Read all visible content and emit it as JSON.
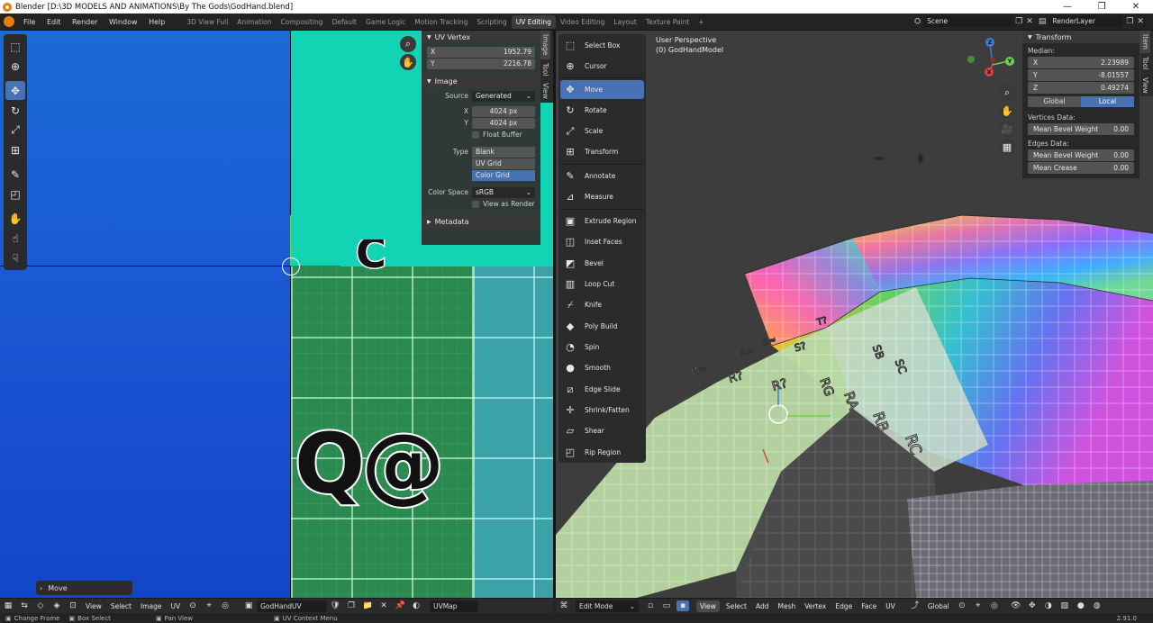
{
  "window": {
    "title": "Blender [D:\\3D MODELS AND ANIMATIONS\\By The Gods\\GodHand.blend]",
    "controls": [
      "—",
      "❐",
      "✕"
    ]
  },
  "topbar": {
    "menus": [
      "File",
      "Edit",
      "Render",
      "Window",
      "Help"
    ],
    "workspaces": [
      "3D View Full",
      "Animation",
      "Compositing",
      "Default",
      "Game Logic",
      "Motion Tracking",
      "Scripting",
      "UV Editing",
      "Video Editing",
      "Layout",
      "Texture Paint"
    ],
    "active_workspace": "UV Editing",
    "add_tab": "+",
    "scene": "Scene",
    "render_layer": "RenderLayer"
  },
  "uv_editor": {
    "uv_vertex": {
      "title": "UV Vertex",
      "x_label": "X",
      "x_value": "1952.79",
      "y_label": "Y",
      "y_value": "2216.78"
    },
    "image": {
      "title": "Image",
      "source_label": "Source",
      "source_value": "Generated",
      "x_label": "X",
      "x_value": "4024 px",
      "y_label": "Y",
      "y_value": "4024 px",
      "float_buffer": "Float Buffer",
      "type_label": "Type",
      "type_options": [
        "Blank",
        "UV Grid",
        "Color Grid"
      ],
      "type_selected": "Color Grid",
      "color_space_label": "Color Space",
      "color_space_value": "sRGB",
      "view_as_render": "View as Render"
    },
    "metadata_title": "Metadata",
    "side_tabs": [
      "Image",
      "Tool",
      "View"
    ],
    "glyph_text": "Q@",
    "glyph_top_text": "C",
    "redo_panel": "Move",
    "header": {
      "menus": [
        "View",
        "Select",
        "Image",
        "UV"
      ],
      "image_name": "GodHandUV",
      "uv_map": "UVMap"
    }
  },
  "viewport": {
    "perspective": "User Perspective",
    "object": "(0) GodHandModel",
    "tools": [
      {
        "label": "Select Box",
        "icon": "⬚"
      },
      {
        "label": "Cursor",
        "icon": "⊕"
      },
      {
        "label": "Move",
        "icon": "✥"
      },
      {
        "label": "Rotate",
        "icon": "↻"
      },
      {
        "label": "Scale",
        "icon": "⤢"
      },
      {
        "label": "Transform",
        "icon": "⊞"
      },
      {
        "label": "Annotate",
        "icon": "✎"
      },
      {
        "label": "Measure",
        "icon": "📐"
      },
      {
        "label": "Extrude Region",
        "icon": "▣"
      },
      {
        "label": "Inset Faces",
        "icon": "◫"
      },
      {
        "label": "Bevel",
        "icon": "◩"
      },
      {
        "label": "Loop Cut",
        "icon": "▥"
      },
      {
        "label": "Knife",
        "icon": "⌿"
      },
      {
        "label": "Poly Build",
        "icon": "◆"
      },
      {
        "label": "Spin",
        "icon": "◔"
      },
      {
        "label": "Smooth",
        "icon": "●"
      },
      {
        "label": "Edge Slide",
        "icon": "⧄"
      },
      {
        "label": "Shrink/Fatten",
        "icon": "✛"
      },
      {
        "label": "Shear",
        "icon": "▱"
      },
      {
        "label": "Rip Region",
        "icon": "◰"
      }
    ],
    "active_tool": "Move",
    "transform": {
      "title": "Transform",
      "median_label": "Median:",
      "x_label": "X",
      "x_value": "2.23989",
      "y_label": "Y",
      "y_value": "-8.01557",
      "z_label": "Z",
      "z_value": "0.49274",
      "orientation": [
        "Global",
        "Local"
      ],
      "orientation_selected": "Local",
      "vertices_data_label": "Vertices Data:",
      "mean_bevel_weight_label": "Mean Bevel Weight",
      "vertex_bevel_value": "0.00",
      "edges_data_label": "Edges Data:",
      "edge_bevel_value": "0.00",
      "mean_crease_label": "Mean Crease",
      "mean_crease_value": "0.00"
    },
    "side_tabs": [
      "Item",
      "Tool",
      "View"
    ],
    "gizmo": {
      "x": "X",
      "y": "Y",
      "z": "Z"
    },
    "face_letters": [
      "RG",
      "RA",
      "RB",
      "RC",
      "SB",
      "SC",
      "R=",
      "R?",
      "S?",
      "T?",
      "S≈",
      "R>",
      "R?"
    ],
    "header": {
      "mode": "Edit Mode",
      "menus": [
        "View",
        "Select",
        "Add",
        "Mesh",
        "Vertex",
        "Edge",
        "Face",
        "UV"
      ],
      "orientation": "Global"
    }
  },
  "statusbar": {
    "items": [
      "Change Frame",
      "Box Select",
      "Pan View",
      "UV Context Menu"
    ],
    "version": "2.91.0"
  },
  "colors": {
    "accent": "#4772b3",
    "uv_blue": "#1a55d2",
    "uv_teal": "#12d3b4",
    "uv_green": "#2a8a4f"
  }
}
